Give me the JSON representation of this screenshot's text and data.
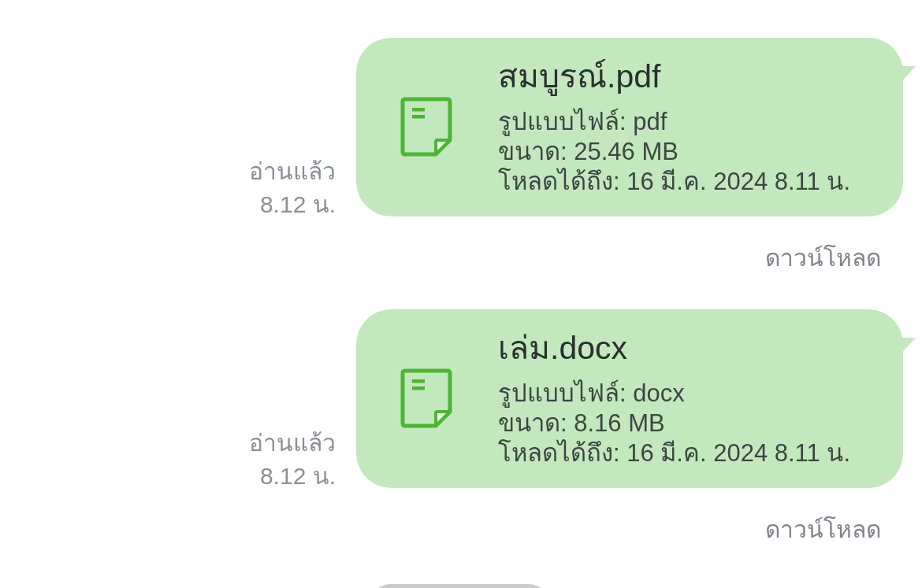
{
  "messages": [
    {
      "kind": "file",
      "read_status": "อ่านแล้ว",
      "time": "8.12 น.",
      "file_name": "สมบูรณ์.pdf",
      "details": [
        "รูปแบบไฟล์: pdf",
        "ขนาด: 25.46 MB",
        "โหลดได้ถึง: 16 มี.ค. 2024 8.11 น."
      ],
      "action": "ดาวน์โหลด"
    },
    {
      "kind": "file",
      "read_status": "อ่านแล้ว",
      "time": "8.12 น.",
      "file_name": "เล่ม.docx",
      "details": [
        "รูปแบบไฟล์: docx",
        "ขนาด: 8.16 MB",
        "โหลดได้ถึง: 16 มี.ค. 2024 8.11 น."
      ],
      "action": "ดาวน์โหลด"
    },
    {
      "kind": "received"
    }
  ]
}
